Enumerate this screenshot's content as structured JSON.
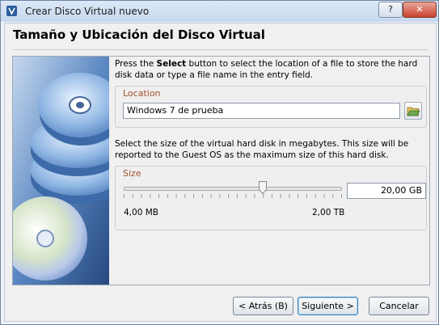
{
  "window": {
    "title": "Crear Disco Virtual nuevo",
    "help_label": "?",
    "close_label": "✕"
  },
  "page": {
    "heading": "Tamaño y Ubicación del Disco Virtual"
  },
  "location_section": {
    "description_pre": "Press the ",
    "description_bold": "Select",
    "description_post": " button to select the location of a file to store the hard disk data or type a file name in the entry field.",
    "group_label": "Location",
    "value": "Windows 7 de prueba",
    "select_icon": "folder-open-icon"
  },
  "size_section": {
    "description": "Select the size of the virtual hard disk in megabytes. This size will be reported to the Guest OS as the maximum size of this hard disk.",
    "group_label": "Size",
    "value": "20,00 GB",
    "min_label": "4,00 MB",
    "max_label": "2,00 TB",
    "slider_fraction": 0.64
  },
  "buttons": {
    "back": "< Atrás (B)",
    "next": "Siguiente >",
    "cancel": "Cancelar"
  },
  "colors": {
    "group_label": "#a0522d",
    "accent": "#3c7fb1"
  }
}
